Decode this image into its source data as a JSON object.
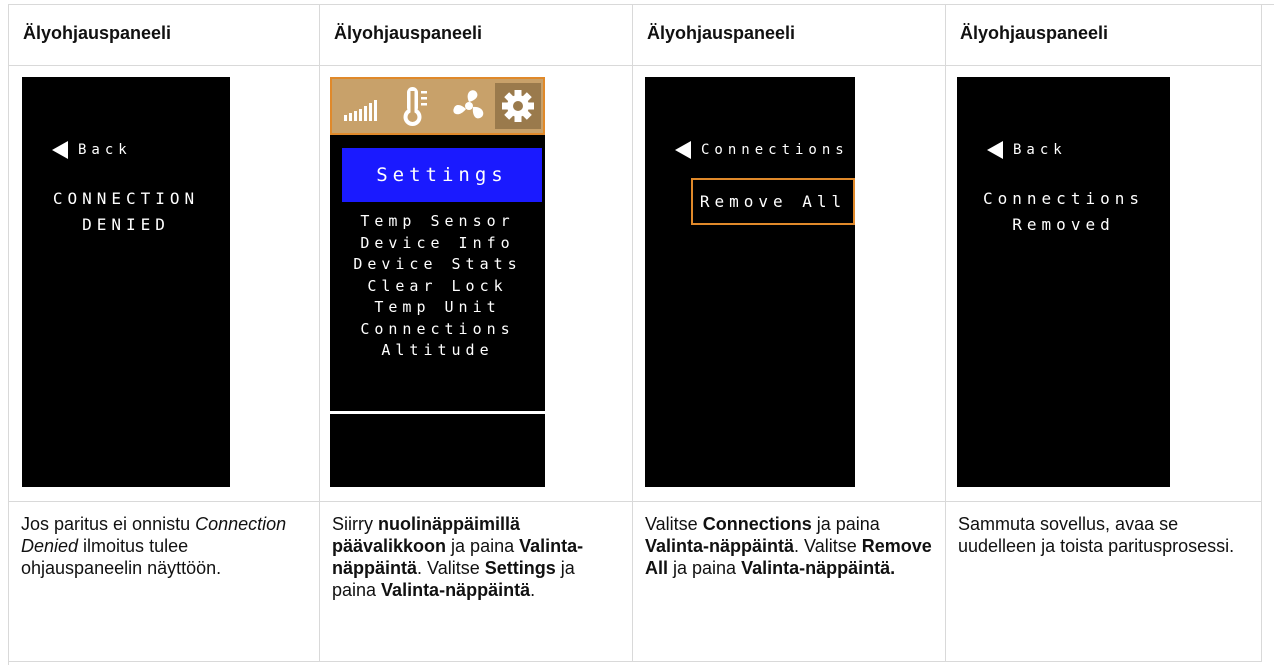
{
  "columns": [
    {
      "header": "Älyohjauspaneeli",
      "screen": {
        "back_label": "Back",
        "message_line1": "CONNECTION",
        "message_line2": "DENIED"
      },
      "text": {
        "p1": "Jos paritus ei onnistu ",
        "p2_italic": "Connection Denied",
        "p3": " ilmoitus tulee ohjauspaneelin näyttöön."
      }
    },
    {
      "header": "Älyohjauspaneeli",
      "screen": {
        "icons": [
          "signal-icon",
          "thermometer-icon",
          "fan-icon",
          "gear-icon"
        ],
        "title": "Settings",
        "menu": [
          "Temp Sensor",
          "Device Info",
          "Device Stats",
          "Clear Lock",
          "Temp Unit",
          "Connections",
          "Altitude"
        ]
      },
      "text": {
        "t1": "Siirry ",
        "b1": "nuolinäppäimillä päävalikkoon",
        "t2": " ja paina ",
        "b2": "Valinta-näppäintä",
        "t3": ". Valitse ",
        "b3": "Settings",
        "t4": " ja paina ",
        "b4": "Valinta-näppäintä",
        "t5": "."
      }
    },
    {
      "header": "Älyohjauspaneeli",
      "screen": {
        "back_label": "Connections",
        "button": "Remove All"
      },
      "text": {
        "t1": "Valitse ",
        "b1": "Connections",
        "t2": " ja paina ",
        "b2": "Valinta-näppäintä",
        "t3": ". Valitse ",
        "b3": "Remove All",
        "t4": " ja paina ",
        "b4": "Valinta-näppäintä."
      }
    },
    {
      "header": "Älyohjauspaneeli",
      "screen": {
        "back_label": "Back",
        "message_line1": "Connections",
        "message_line2": "Removed"
      },
      "text": {
        "p1": "Sammuta sovellus, avaa se uudelleen ja toista paritusprosessi."
      }
    }
  ],
  "colors": {
    "screen_bg": "#000000",
    "iconbar_bg": "#c8a16a",
    "accent_orange": "#e0892a",
    "settings_blue": "#1a1aff"
  }
}
